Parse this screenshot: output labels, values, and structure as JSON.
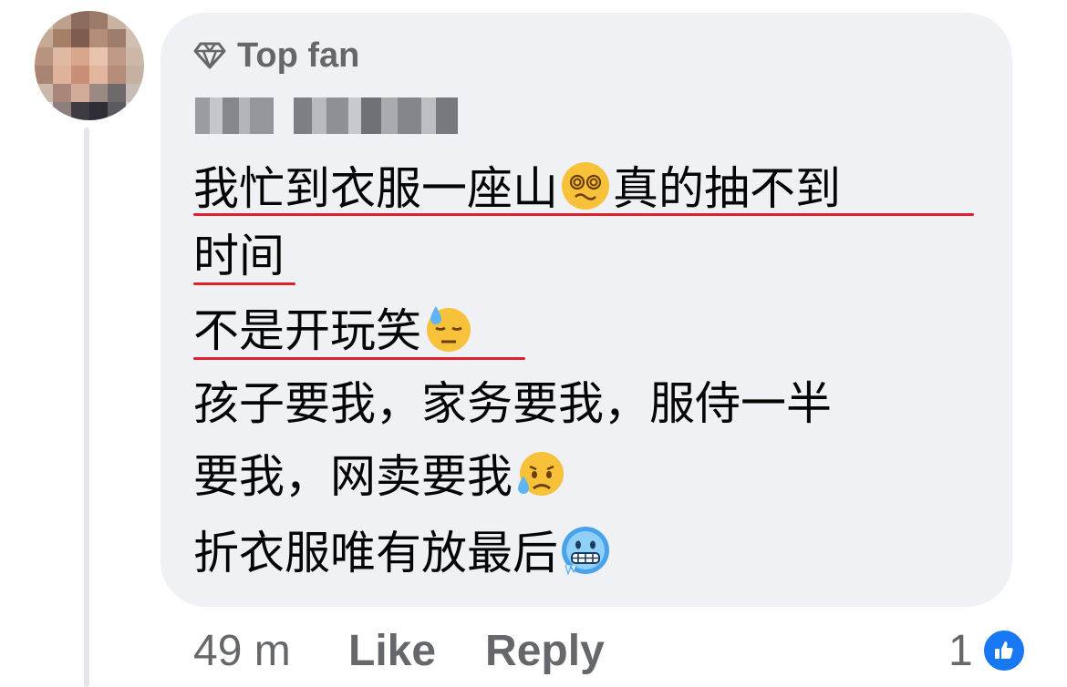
{
  "comment": {
    "badge_label": "Top fan",
    "badge_icon": "diamond-icon",
    "lines": [
      {
        "parts": [
          "我忙到衣服一座山",
          "真的抽不到"
        ],
        "emoji": "dizzy-face-emoji"
      },
      {
        "parts": [
          "时间"
        ]
      },
      {
        "parts": [
          "不是开玩笑"
        ],
        "emoji": "downcast-sweat-emoji"
      },
      {
        "parts": [
          "孩子要我，家务要我，服侍一半"
        ]
      },
      {
        "parts": [
          "要我，网卖要我"
        ],
        "emoji": "sad-relieved-emoji"
      },
      {
        "parts": [
          "折衣服唯有放最后"
        ],
        "emoji": "cold-face-emoji"
      }
    ]
  },
  "footer": {
    "time": "49 m",
    "like_label": "Like",
    "reply_label": "Reply",
    "reaction_count": "1",
    "reaction_icon": "like-thumb-icon"
  },
  "colors": {
    "bubble": "#eff1f5",
    "underline": "#e0202a",
    "meta_text": "#65676b",
    "like_blue": "#1877f2"
  }
}
